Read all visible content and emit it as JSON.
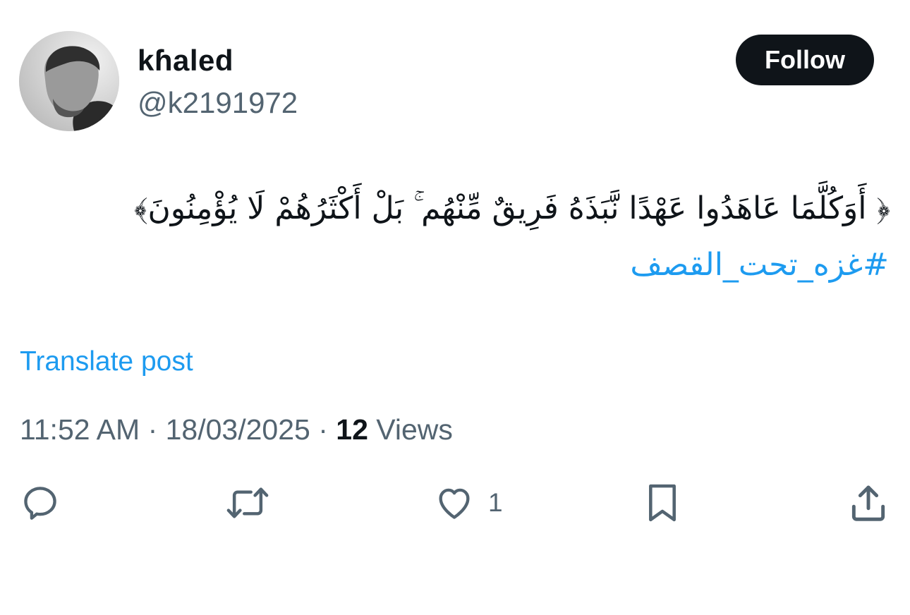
{
  "user": {
    "display_name": "kɦaled",
    "handle": "@k2191972",
    "follow_label": "Follow"
  },
  "post": {
    "text": "﴿ أَوَكُلَّمَا عَاهَدُوا عَهْدًا نَّبَذَهُ فَرِيقٌ مِّنْهُم ۚ بَلْ أَكْثَرُهُمْ لَا يُؤْمِنُونَ﴾",
    "hashtag": "#غزه_تحت_القصف",
    "translate_label": "Translate post",
    "time": "11:52 AM",
    "separator": " · ",
    "date": "18/03/2025",
    "views_count": "12",
    "views_label": " Views"
  },
  "actions": {
    "reply_icon": "reply-icon",
    "repost_icon": "repost-icon",
    "like_icon": "heart-icon",
    "like_count": "1",
    "bookmark_icon": "bookmark-icon",
    "share_icon": "share-icon"
  },
  "colors": {
    "link": "#1d9bf0",
    "muted": "#536471",
    "text": "#0f1419"
  }
}
